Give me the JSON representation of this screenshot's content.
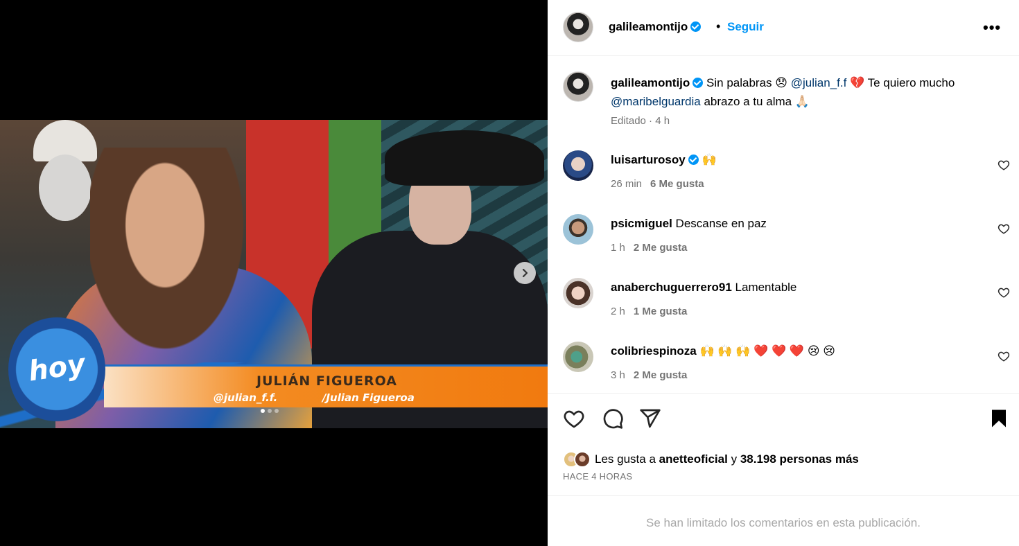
{
  "post": {
    "media": {
      "lower_third_name": "JULIÁN FIGUEROA",
      "lower_third_instagram": "@julian_f.f.",
      "lower_third_facebook": "/Julian Figueroa",
      "show_logo_text": "hoy",
      "slide_count": 3,
      "active_slide": 1
    },
    "header": {
      "username": "galileamontijo",
      "verified": true,
      "separator": "•",
      "follow_label": "Seguir",
      "more_label": "•••"
    },
    "caption": {
      "username": "galileamontijo",
      "text_1": "Sin palabras 😞",
      "mention_1": "@julian_f.f",
      "text_2": "💔 Te quiero mucho",
      "mention_2": "@maribelguardia",
      "text_3": "abrazo a tu alma 🙏🏻",
      "meta": "Editado · 4 h"
    },
    "comments": [
      {
        "username": "luisarturosoy",
        "verified": true,
        "text": "🙌",
        "time": "26 min",
        "likes": "6 Me gusta"
      },
      {
        "username": "psicmiguel",
        "verified": false,
        "text": "Descanse en paz",
        "time": "1 h",
        "likes": "2 Me gusta"
      },
      {
        "username": "anaberchuguerrero91",
        "verified": false,
        "text": "Lamentable",
        "time": "2 h",
        "likes": "1 Me gusta"
      },
      {
        "username": "colibriespinoza",
        "verified": false,
        "text": "🙌 🙌 🙌 ❤️ ❤️ ❤️ 😢 😢",
        "time": "3 h",
        "likes": "2 Me gusta"
      }
    ],
    "likes": {
      "prefix": "Les gusta a",
      "user": "anetteoficial",
      "middle": "y",
      "others": "38.198 personas más"
    },
    "posted_ago": "HACE 4 HORAS",
    "comments_limited": "Se han limitado los comentarios en esta publicación."
  },
  "colors": {
    "accent": "#0095f6",
    "mention": "#00376b",
    "muted": "#737373"
  }
}
